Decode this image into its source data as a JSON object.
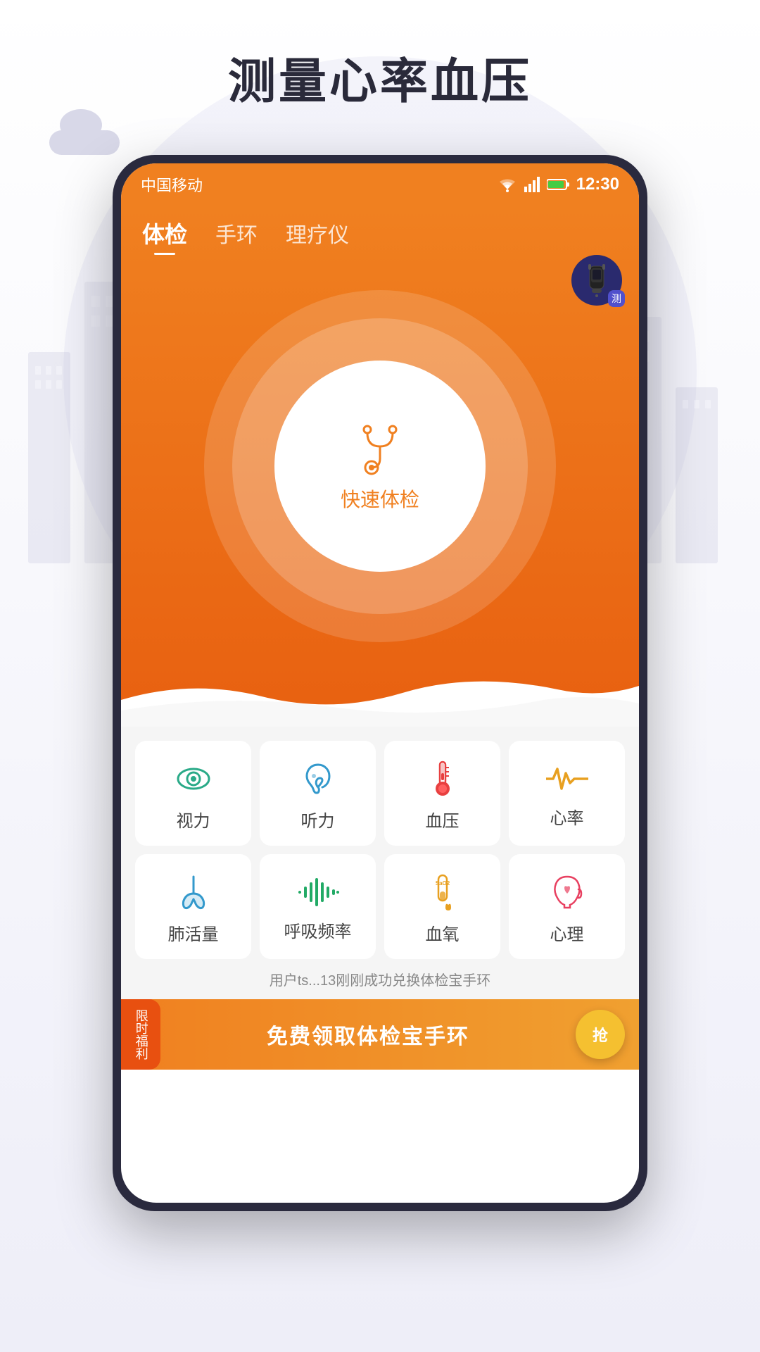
{
  "page": {
    "title": "测量心率血压",
    "background_color": "#f0f0f8"
  },
  "status_bar": {
    "carrier": "中国移动",
    "time": "12:30"
  },
  "tabs": [
    {
      "label": "体检",
      "active": true
    },
    {
      "label": "手环",
      "active": false
    },
    {
      "label": "理疗仪",
      "active": false
    }
  ],
  "device_badge": {
    "label": "测"
  },
  "scan_button": {
    "label": "快速体检"
  },
  "health_items": [
    {
      "label": "视力",
      "icon_type": "eye"
    },
    {
      "label": "听力",
      "icon_type": "ear"
    },
    {
      "label": "血压",
      "icon_type": "thermometer"
    },
    {
      "label": "心率",
      "icon_type": "heartrate"
    },
    {
      "label": "肺活量",
      "icon_type": "lung"
    },
    {
      "label": "呼吸频率",
      "icon_type": "soundwave"
    },
    {
      "label": "血氧",
      "icon_type": "bloodtube"
    },
    {
      "label": "心理",
      "icon_type": "mind"
    }
  ],
  "notification": {
    "text": "用户ts...13刚刚成功兑换体检宝手环"
  },
  "banner": {
    "badge": "限时福利",
    "text": "免费领取体检宝手环",
    "button": "抢"
  }
}
